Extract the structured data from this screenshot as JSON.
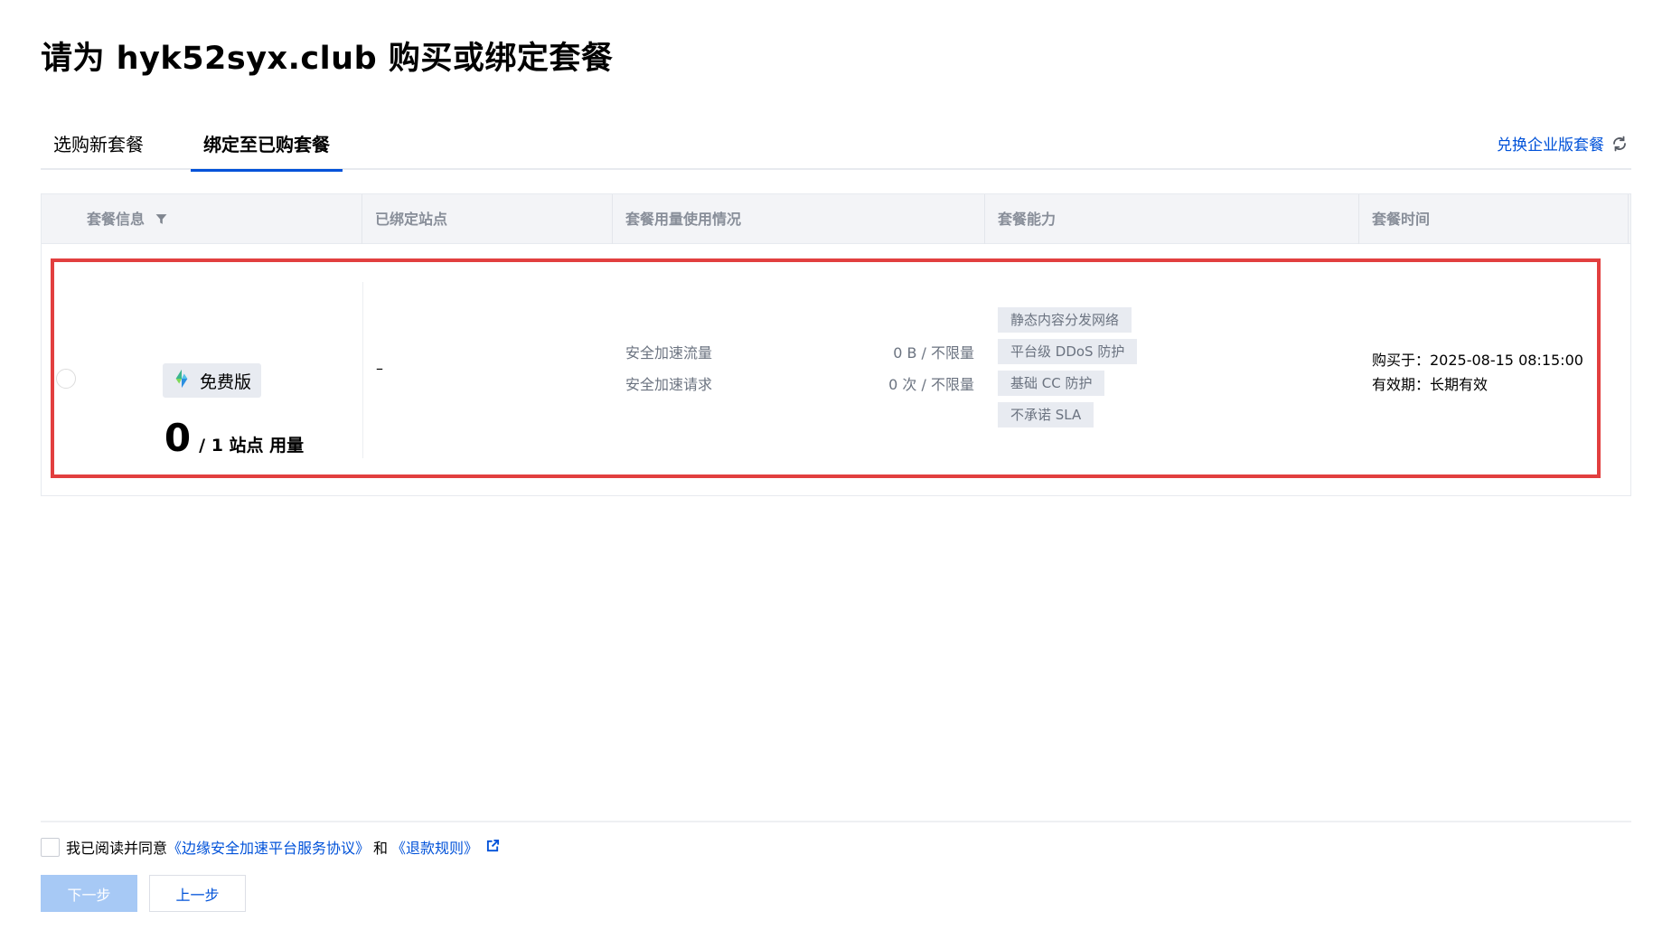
{
  "page": {
    "title": "请为 hyk52syx.club 购买或绑定套餐"
  },
  "tabs": [
    {
      "label": "选购新套餐",
      "active": false
    },
    {
      "label": "绑定至已购套餐",
      "active": true
    }
  ],
  "header_action": {
    "label": "兑换企业版套餐",
    "icon": "refresh-icon"
  },
  "table": {
    "columns": [
      "套餐信息",
      "已绑定站点",
      "套餐用量使用情况",
      "套餐能力",
      "套餐时间"
    ],
    "rows": [
      {
        "selected": false,
        "plan_badge": {
          "icon": "edgeone-logo-icon",
          "label": "免费版"
        },
        "usage": {
          "used": "0",
          "text": "/ 1 站点 用量"
        },
        "bound_site": "–",
        "metrics": [
          {
            "label": "安全加速流量",
            "value": "0 B / 不限量"
          },
          {
            "label": "安全加速请求",
            "value": "0 次 / 不限量"
          }
        ],
        "capabilities": [
          "静态内容分发网络",
          "平台级 DDoS 防护",
          "基础 CC 防护",
          "不承诺 SLA"
        ],
        "purchased_at": "购买于：2025-08-15 08:15:00",
        "validity": "有效期：长期有效"
      }
    ]
  },
  "agreement": {
    "prefix": "我已阅读并同意",
    "link1": "《边缘安全加速平台服务协议》",
    "and": "和",
    "link2": "《退款规则》"
  },
  "buttons": {
    "next": "下一步",
    "prev": "上一步"
  },
  "colors": {
    "primary": "#0052d9",
    "highlight": "#e23f3f",
    "disabled_primary": "#a7c9f5"
  }
}
